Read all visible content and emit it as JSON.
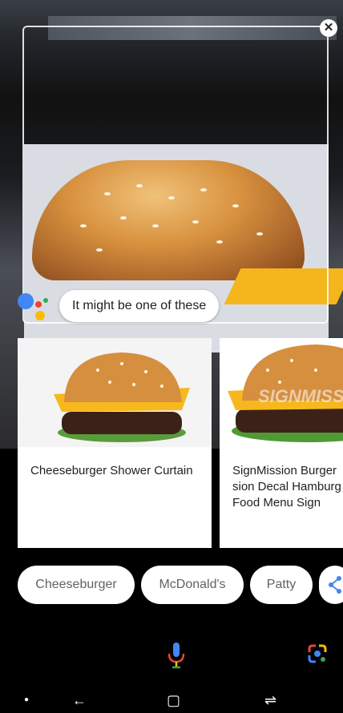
{
  "overlay": {
    "close_icon": "close-icon",
    "prompt": "It might be one of these"
  },
  "results": [
    {
      "title": "Cheeseburger Shower Curtain"
    },
    {
      "title": "SignMission Burger\nsion Decal Hamburg\nFood Menu Sign",
      "watermark": "SIGNMISS"
    }
  ],
  "chips": [
    {
      "label": "Cheeseburger"
    },
    {
      "label": "McDonald's"
    },
    {
      "label": "Patty"
    },
    {
      "icon": "share-icon"
    }
  ],
  "bottom_bar": {
    "mic_icon": "mic-icon",
    "lens_icon": "lens-icon"
  },
  "colors": {
    "google_blue": "#4285F4",
    "google_red": "#EA4335",
    "google_yellow": "#FBBC05",
    "google_green": "#34A853"
  }
}
